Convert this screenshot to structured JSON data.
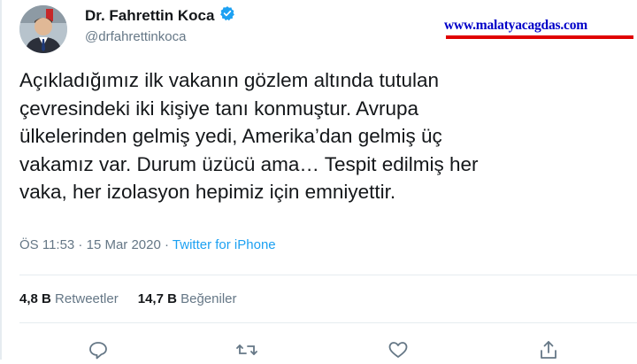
{
  "author": {
    "display_name": "Dr. Fahrettin Koca",
    "handle": "@drfahrettinkoca",
    "verified_icon": "verified-badge-icon"
  },
  "watermark": {
    "text": "www.malatyacagdas.com"
  },
  "tweet": {
    "lines": [
      "Açıkladığımız ilk vakanın gözlem altında tutulan",
      "çevresindeki iki kişiye tanı konmuştur. Avrupa",
      "ülkelerinden gelmiş yedi, Amerika’dan gelmiş üç",
      "vakamız var. Durum üzücü ama… Tespit edilmiş her",
      "vaka, her izolasyon hepimiz için emniyettir."
    ]
  },
  "meta": {
    "time": "ÖS 11:53",
    "separator": " · ",
    "date": "15 Mar 2020",
    "source": "Twitter for iPhone"
  },
  "stats": {
    "retweets_count": "4,8 B",
    "retweets_label": "Retweetler",
    "likes_count": "14,7 B",
    "likes_label": "Beğeniler"
  },
  "actions": [
    "reply-icon",
    "retweet-icon",
    "like-icon",
    "share-icon"
  ],
  "colors": {
    "text": "#14171a",
    "secondary": "#657786",
    "link": "#1da1f2",
    "verified": "#1da1f2",
    "watermark_text": "#0000c8",
    "watermark_bar": "#e00000"
  }
}
